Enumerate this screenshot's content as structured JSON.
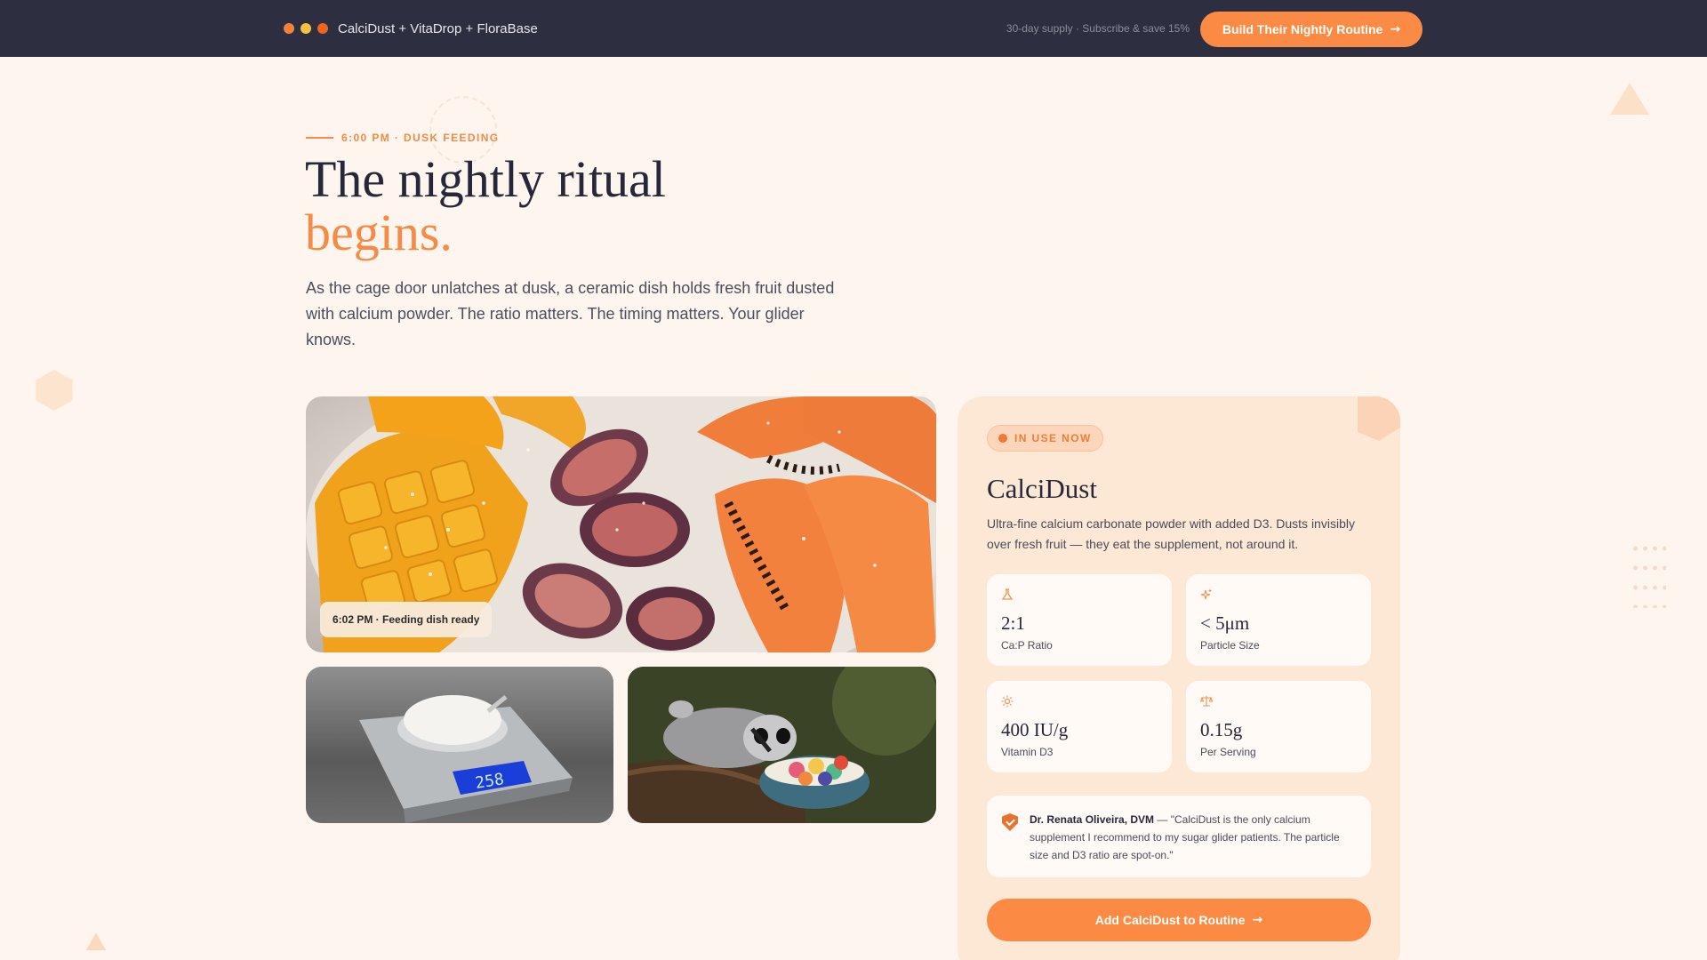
{
  "header": {
    "window_dots": [
      "#f7813a",
      "#f5c341",
      "#f0641f"
    ],
    "brand": "CalciDust + VitaDrop + FloraBase",
    "promo": "30-day supply · Subscribe & save 15%",
    "cta_label": "Build Their Nightly Routine",
    "cta_icon": "arrow-right-icon"
  },
  "hero": {
    "eyebrow": "6:00 PM · DUSK FEEDING",
    "title_line1": "The nightly ritual",
    "title_line2": "begins.",
    "lede": "As the cage door unlatches at dusk, a ceramic dish holds fresh fruit dusted with calcium powder. The ratio matters. The timing matters. Your glider knows."
  },
  "gallery": {
    "main_caption": "6:02 PM · Feeding dish ready",
    "main_image": "fruit-dish-image",
    "scale_image": "kitchen-scale-image",
    "scale_display": "258",
    "glider_image": "sugar-glider-image"
  },
  "product": {
    "badge": "IN USE NOW",
    "name": "CalciDust",
    "description": "Ultra-fine calcium carbonate powder with added D3. Dusts invisibly over fresh fruit — they eat the supplement, not around it.",
    "stats": [
      {
        "icon": "flask-icon",
        "value": "2:1",
        "label": "Ca:P Ratio"
      },
      {
        "icon": "sparkle-icon",
        "value": "< 5μm",
        "label": "Particle Size"
      },
      {
        "icon": "sun-icon",
        "value": "400 IU/g",
        "label": "Vitamin D3"
      },
      {
        "icon": "scale-icon",
        "value": "0.15g",
        "label": "Per Serving"
      }
    ],
    "testimonial": {
      "author": "Dr. Renata Oliveira, DVM",
      "quote": " — \"CalciDust is the only calcium supplement I recommend to my sugar glider patients. The particle size and D3 ratio are spot-on.\""
    },
    "cta_label": "Add CalciDust to Routine"
  },
  "colors": {
    "accent": "#fb8a44",
    "topbar": "#2d2e3f",
    "background": "#fdf5ee",
    "card": "#fde8d6"
  }
}
